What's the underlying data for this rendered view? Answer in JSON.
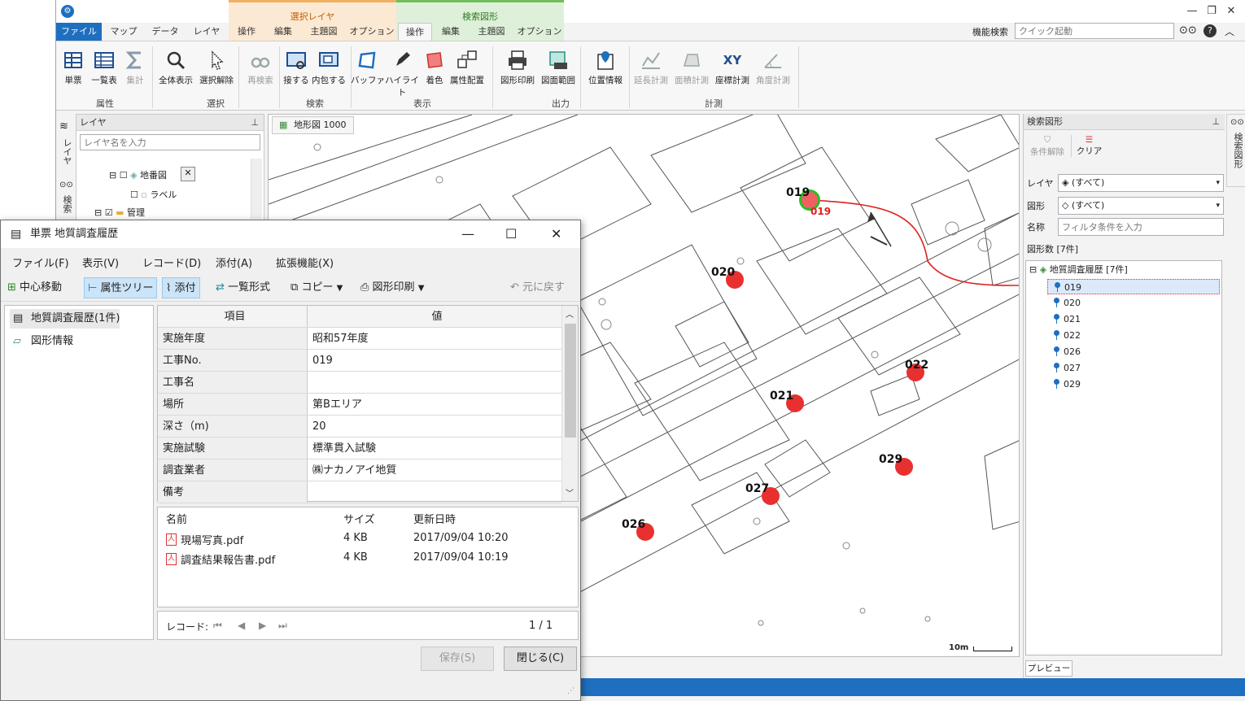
{
  "main": {
    "context_tabs": {
      "selected_layer": "選択レイヤ",
      "search_figure": "検索図形"
    },
    "tabs": [
      "ファイル",
      "マップ",
      "データ",
      "レイヤ",
      "操作",
      "編集",
      "主題図",
      "オプション",
      "操作",
      "編集",
      "主題図",
      "オプション"
    ],
    "func_search_label": "機能検索",
    "func_search_placeholder": "クイック起動",
    "ribbon": {
      "buttons": [
        "単票",
        "一覧表",
        "集計",
        "全体表示",
        "選択解除",
        "再検索",
        "接する",
        "内包する",
        "バッファ",
        "ハイライト",
        "着色",
        "属性配置",
        "図形印刷",
        "図面範囲",
        "位置情報",
        "延長計測",
        "面積計測",
        "座標計測",
        "角度計測"
      ],
      "groups": [
        "属性",
        "選択",
        "検索",
        "表示",
        "出力",
        "計測"
      ]
    },
    "left_strip": {
      "layer_label": "レイヤ",
      "search_label": "検索"
    },
    "layer_panel": {
      "title": "レイヤ",
      "filter_placeholder": "レイヤ名を入力",
      "items": [
        "地番図",
        "ラベル",
        "管理"
      ]
    },
    "map": {
      "tab_label": "地形図 1000",
      "points": [
        "019",
        "020",
        "021",
        "022",
        "026",
        "027",
        "029"
      ],
      "selected_label": "019",
      "scale_label": "10m"
    },
    "search_panel": {
      "title": "検索図形",
      "clear_conditions": "条件解除",
      "clear": "クリア",
      "layer_label": "レイヤ",
      "layer_value": "(すべて)",
      "shape_label": "図形",
      "shape_value": "(すべて)",
      "name_label": "名称",
      "name_placeholder": "フィルタ条件を入力",
      "count_label": "図形数 [7件]",
      "tree_root": "地質調査履歴 [7件]",
      "tree_items": [
        "019",
        "020",
        "021",
        "022",
        "026",
        "027",
        "029"
      ],
      "preview_button": "プレビュー"
    },
    "right_strip_label": "検索図形"
  },
  "dialog": {
    "title": "単票 地質調査履歴",
    "menu": [
      "ファイル(F)",
      "表示(V)",
      "レコード(D)",
      "添付(A)",
      "拡張機能(X)"
    ],
    "toolbar": [
      "中心移動",
      "属性ツリー",
      "添付",
      "一覧形式",
      "コピー",
      "図形印刷",
      "元に戻す"
    ],
    "tree": [
      "地質調査履歴(1件)",
      "図形情報"
    ],
    "grid_headers": [
      "項目",
      "値"
    ],
    "grid_rows": [
      {
        "k": "実施年度",
        "v": "昭和57年度"
      },
      {
        "k": "工事No.",
        "v": "019"
      },
      {
        "k": "工事名",
        "v": ""
      },
      {
        "k": "場所",
        "v": "第Bエリア"
      },
      {
        "k": "深さ（m)",
        "v": "20"
      },
      {
        "k": "実施試験",
        "v": "標準貫入試験"
      },
      {
        "k": "調査業者",
        "v": "㈱ナカノアイ地質"
      },
      {
        "k": "備考",
        "v": ""
      }
    ],
    "file_headers": [
      "名前",
      "サイズ",
      "更新日時"
    ],
    "files": [
      {
        "name": "現場写真.pdf",
        "size": "4 KB",
        "date": "2017/09/04 10:20"
      },
      {
        "name": "調査結果報告書.pdf",
        "size": "4 KB",
        "date": "2017/09/04 10:19"
      }
    ],
    "record_label": "レコード:",
    "record_pos": "1 / 1",
    "save_button": "保存(S)",
    "close_button": "閉じる(C)"
  },
  "colors": {
    "accent": "#1e6fbf",
    "marker": "#e83030",
    "selected_ring": "#2bbd2b",
    "route": "#e02020"
  }
}
